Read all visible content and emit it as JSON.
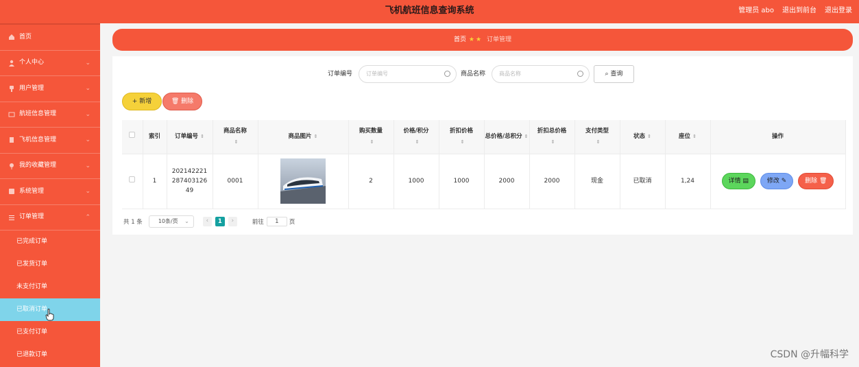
{
  "app": {
    "title": "飞机航班信息查询系统",
    "admin": "管理员 abo",
    "exit_front": "退出到前台",
    "logout": "退出登录"
  },
  "sidebar": {
    "items": [
      {
        "label": "首页",
        "icon": "home-icon"
      },
      {
        "label": "个人中心",
        "icon": "user-icon"
      },
      {
        "label": "用户管理",
        "icon": "users-icon"
      },
      {
        "label": "航班信息管理",
        "icon": "flight-icon"
      },
      {
        "label": "飞机信息管理",
        "icon": "plane-icon"
      },
      {
        "label": "我的收藏管理",
        "icon": "star-icon"
      },
      {
        "label": "系统管理",
        "icon": "gear-icon"
      },
      {
        "label": "订单管理",
        "icon": "list-icon"
      }
    ],
    "submenu": [
      "已完成订单",
      "已发货订单",
      "未支付订单",
      "已取消订单",
      "已支付订单",
      "已退款订单"
    ],
    "active_submenu": "已取消订单"
  },
  "breadcrumb": {
    "home": "首页",
    "current": "订单管理"
  },
  "search": {
    "order_label": "订单编号",
    "order_placeholder": "订单编号",
    "product_label": "商品名称",
    "product_placeholder": "商品名称",
    "button": "查询"
  },
  "actions": {
    "add": "新增",
    "delete": "删除"
  },
  "table": {
    "headers": [
      "索引",
      "订单编号",
      "商品名称",
      "商品图片",
      "购买数量",
      "价格/积分",
      "折扣价格",
      "总价格/总积分",
      "折扣总价格",
      "支付类型",
      "状态",
      "座位",
      "操作"
    ],
    "rows": [
      {
        "index": "1",
        "order_no": "202142221287403126 49",
        "order_no_lines": [
          "202142221",
          "287403126",
          "49"
        ],
        "product_name": "0001",
        "quantity": "2",
        "price": "1000",
        "discount_price": "1000",
        "total_price": "2000",
        "discount_total": "2000",
        "pay_type": "现金",
        "status": "已取消",
        "seat": "1,24"
      }
    ],
    "row_actions": {
      "detail": "详情",
      "edit": "修改",
      "remove": "删除"
    }
  },
  "pager": {
    "total": "共 1 条",
    "page_size": "10条/页",
    "current_page": "1",
    "goto_label": "前往",
    "goto_value": "1",
    "page_unit": "页"
  },
  "watermark": "CSDN @升幅科学",
  "colors": {
    "primary": "#f5563a",
    "active_submenu": "#7fd4ea",
    "add_button": "#f5d13a",
    "detail_button": "#5cd65c",
    "edit_button": "#7ea7f5",
    "remove_button": "#f5604a",
    "page_active": "#14a0a0"
  }
}
